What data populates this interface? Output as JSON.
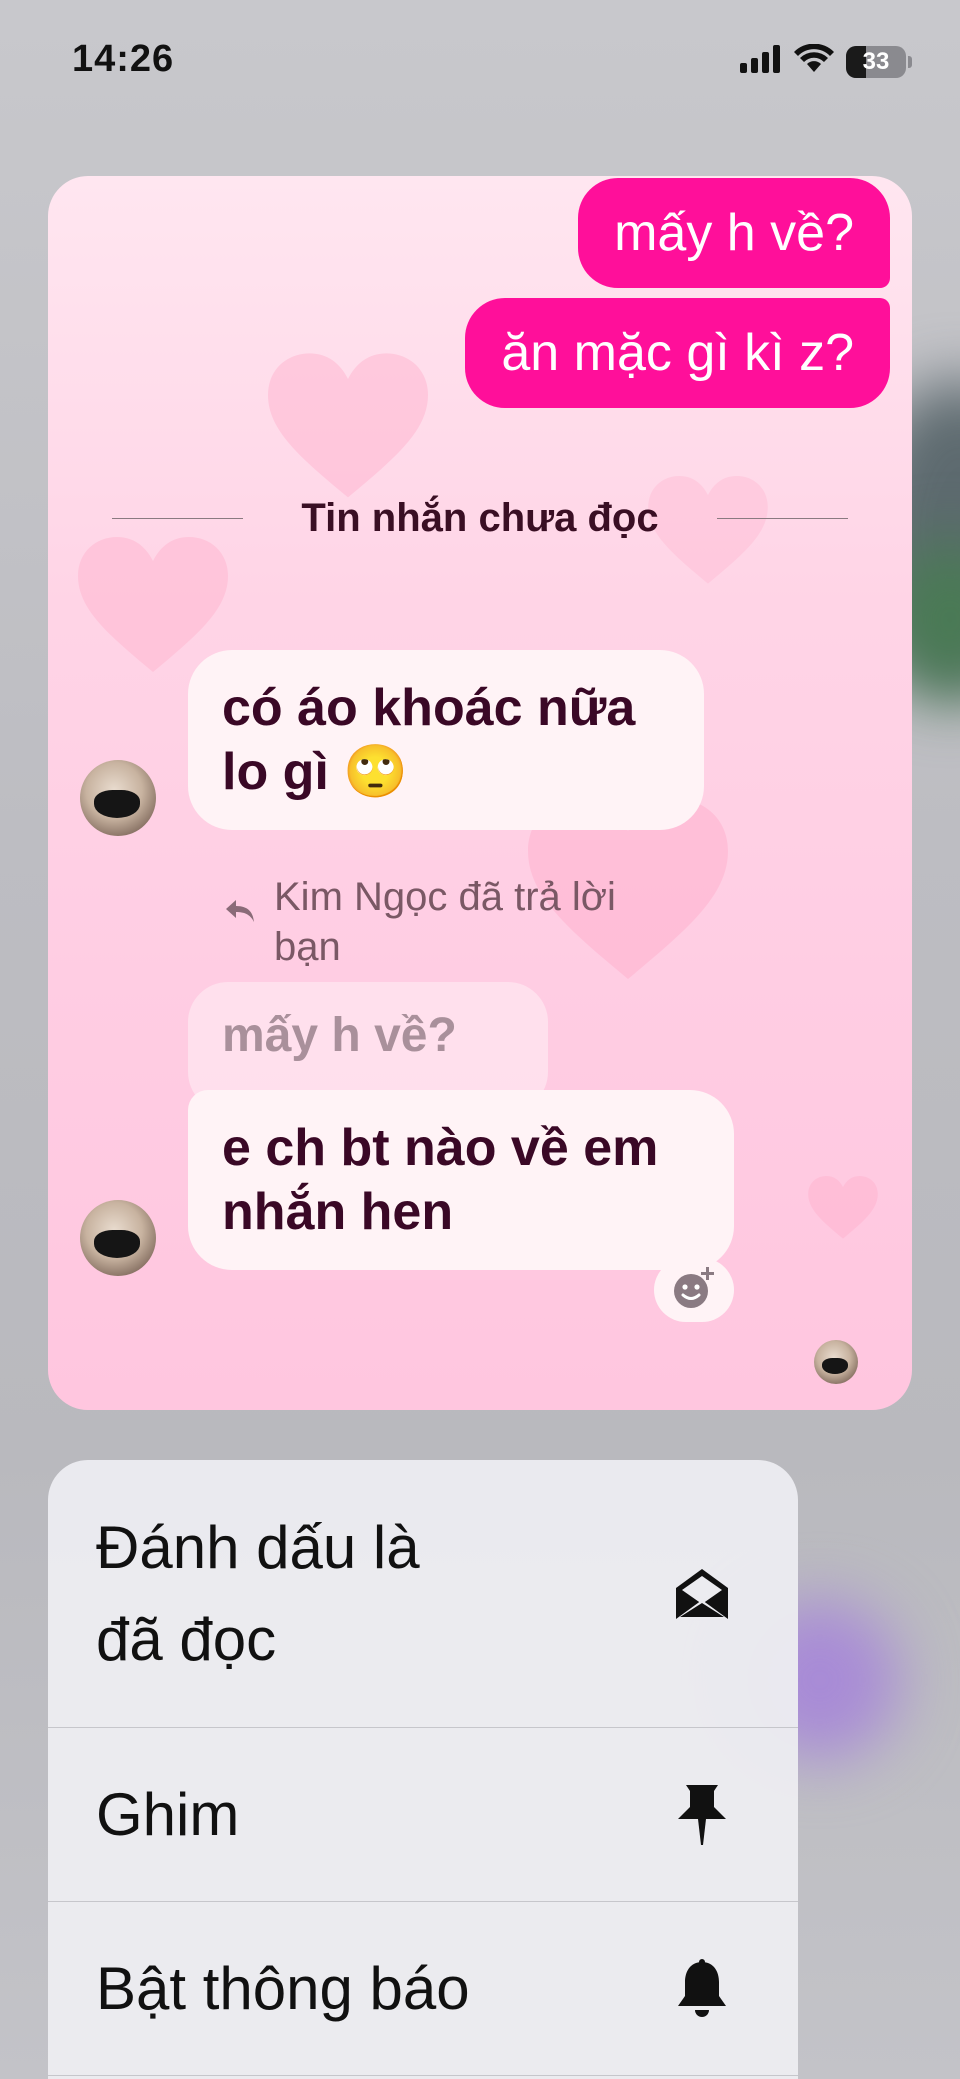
{
  "status_bar": {
    "time": "14:26",
    "battery_level": "33"
  },
  "chat": {
    "outgoing": [
      {
        "text": "mấy h về?"
      },
      {
        "text": "ăn mặc gì kì z?"
      }
    ],
    "unread_divider": "Tin nhắn chưa đọc",
    "incoming": [
      {
        "text": "có áo khoác nữa lo gì 🙄"
      },
      {
        "text": "e ch bt nào về em nhắn hen"
      }
    ],
    "reply_label": "Kim Ngọc đã trả lời bạn",
    "quoted_text": "mấy h về?",
    "accent_color": "#ff0f9a",
    "theme": "pink hearts"
  },
  "menu": {
    "items": [
      {
        "label": "Đánh dấu là\nđã đọc",
        "icon": "envelope-open-icon"
      },
      {
        "label": "Ghim",
        "icon": "pin-icon"
      },
      {
        "label": "Bật thông báo",
        "icon": "bell-icon"
      }
    ]
  }
}
